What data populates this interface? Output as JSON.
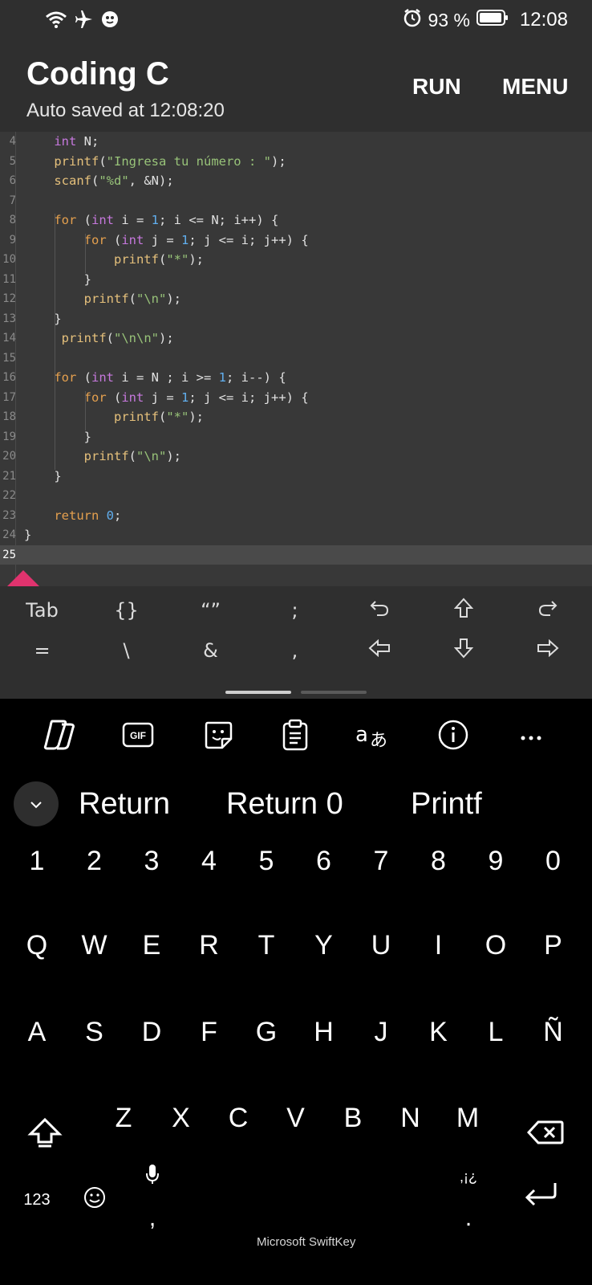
{
  "status_bar": {
    "battery": "93 %",
    "time": "12:08",
    "icons": [
      "wifi-icon",
      "airplane-icon",
      "app-notification-icon",
      "alarm-icon",
      "battery-icon"
    ]
  },
  "header": {
    "title": "Coding C",
    "subtitle": "Auto saved at 12:08:20",
    "run_label": "RUN",
    "menu_label": "MENU"
  },
  "editor": {
    "lines": [
      {
        "n": "4",
        "text": "    int N;"
      },
      {
        "n": "5",
        "text": "    printf(\"Ingresa tu número : \");"
      },
      {
        "n": "6",
        "text": "    scanf(\"%d\", &N);"
      },
      {
        "n": "7",
        "text": ""
      },
      {
        "n": "8",
        "text": "    for (int i = 1; i <= N; i++) {"
      },
      {
        "n": "9",
        "text": "        for (int j = 1; j <= i; j++) {"
      },
      {
        "n": "10",
        "text": "            printf(\"*\");"
      },
      {
        "n": "11",
        "text": "        }"
      },
      {
        "n": "12",
        "text": "        printf(\"\\n\");"
      },
      {
        "n": "13",
        "text": "    }"
      },
      {
        "n": "14",
        "text": "     printf(\"\\n\\n\");"
      },
      {
        "n": "15",
        "text": ""
      },
      {
        "n": "16",
        "text": "    for (int i = N ; i >= 1; i--) {"
      },
      {
        "n": "17",
        "text": "        for (int j = 1; j <= i; j++) {"
      },
      {
        "n": "18",
        "text": "            printf(\"*\");"
      },
      {
        "n": "19",
        "text": "        }"
      },
      {
        "n": "20",
        "text": "        printf(\"\\n\");"
      },
      {
        "n": "21",
        "text": "    }"
      },
      {
        "n": "22",
        "text": ""
      },
      {
        "n": "23",
        "text": "    return 0;"
      },
      {
        "n": "24",
        "text": "}"
      },
      {
        "n": "25",
        "text": ""
      }
    ]
  },
  "symbol_bar": {
    "row1": [
      "Tab",
      "{}",
      "“”",
      ";",
      "undo-icon",
      "shift-up-icon",
      "redo-icon"
    ],
    "row1_labels": {
      "tab": "Tab",
      "braces": "{}",
      "quotes": "“”",
      "semicolon": ";"
    },
    "row2_labels": {
      "equals": "=",
      "backslash": "\\",
      "ampersand": "&",
      "comma": ","
    }
  },
  "keyboard": {
    "suggestions": [
      "Return",
      "Return 0",
      "Printf"
    ],
    "number_row": [
      "1",
      "2",
      "3",
      "4",
      "5",
      "6",
      "7",
      "8",
      "9",
      "0"
    ],
    "row1": [
      "Q",
      "W",
      "E",
      "R",
      "T",
      "Y",
      "U",
      "I",
      "O",
      "P"
    ],
    "row2": [
      "A",
      "S",
      "D",
      "F",
      "G",
      "H",
      "J",
      "K",
      "L",
      "Ñ"
    ],
    "row3": [
      "Z",
      "X",
      "C",
      "V",
      "B",
      "N",
      "M"
    ],
    "numbers_key": "123",
    "comma": ",",
    "period": ".",
    "punct_hint": ",¡¿",
    "brand": "Microsoft SwiftKey"
  }
}
